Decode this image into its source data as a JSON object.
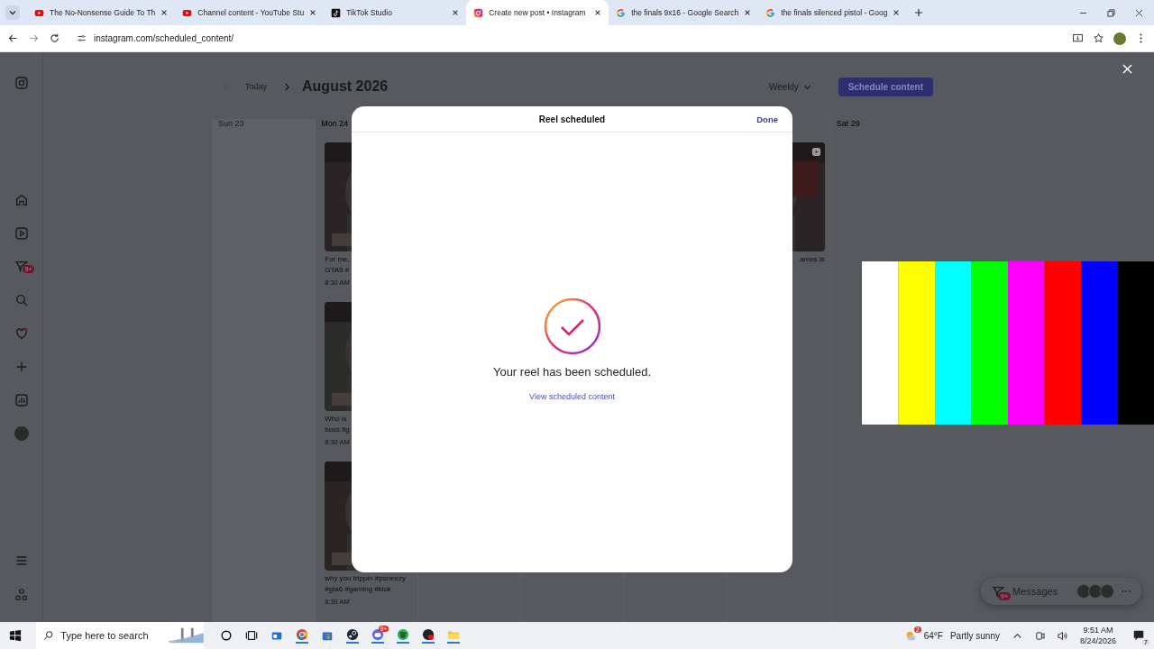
{
  "browser": {
    "tabs": [
      {
        "title": "The No-Nonsense Guide To Th",
        "kind": "youtube",
        "selected": false
      },
      {
        "title": "Channel content - YouTube Stu",
        "kind": "youtube",
        "selected": false
      },
      {
        "title": "TikTok Studio",
        "kind": "tiktok",
        "selected": false
      },
      {
        "title": "Create new post • Instagram",
        "kind": "instagram",
        "selected": true
      },
      {
        "title": "the finals 9x16 - Google Search",
        "kind": "google",
        "selected": false
      },
      {
        "title": "the finals silenced pistol - Goog",
        "kind": "google",
        "selected": false
      }
    ],
    "address": "instagram.com/scheduled_content/"
  },
  "sidebar": {
    "messages_badge": "9+"
  },
  "calendar": {
    "today": "Today",
    "month": "August 2026",
    "view": "Weekly",
    "schedule_button": "Schedule content",
    "columns": [
      {
        "label": "Sun 23",
        "past": true
      },
      {
        "label": "Mon 24",
        "past": false,
        "posts": [
          {
            "caption": [
              "For me,",
              "GTA5 #"
            ],
            "time": "8:30 AM"
          },
          {
            "caption": [
              "Who is",
              "boss fig"
            ],
            "time": "8:30 AM"
          },
          {
            "caption": [
              "why you trippin #psneezy",
              "#gta6 #gaming #kick"
            ],
            "time": "8:30 AM"
          }
        ]
      },
      {},
      {},
      {},
      {
        "posts": [
          {
            "caption": [
              "ames is"
            ]
          }
        ]
      },
      {
        "label": "Sat 29",
        "past": false
      }
    ]
  },
  "modal": {
    "title": "Reel scheduled",
    "done": "Done",
    "message": "Your reel has been scheduled.",
    "link": "View scheduled content"
  },
  "messages": {
    "label": "Messages",
    "badge": "9+"
  },
  "taskbar": {
    "search_placeholder": "Type here to search",
    "chat_badge": "9+",
    "weather_badge": "2",
    "temperature": "64°F",
    "weather": "Partly sunny",
    "time": "9:51 AM",
    "date": "8/24/2026",
    "notifications": "7"
  }
}
